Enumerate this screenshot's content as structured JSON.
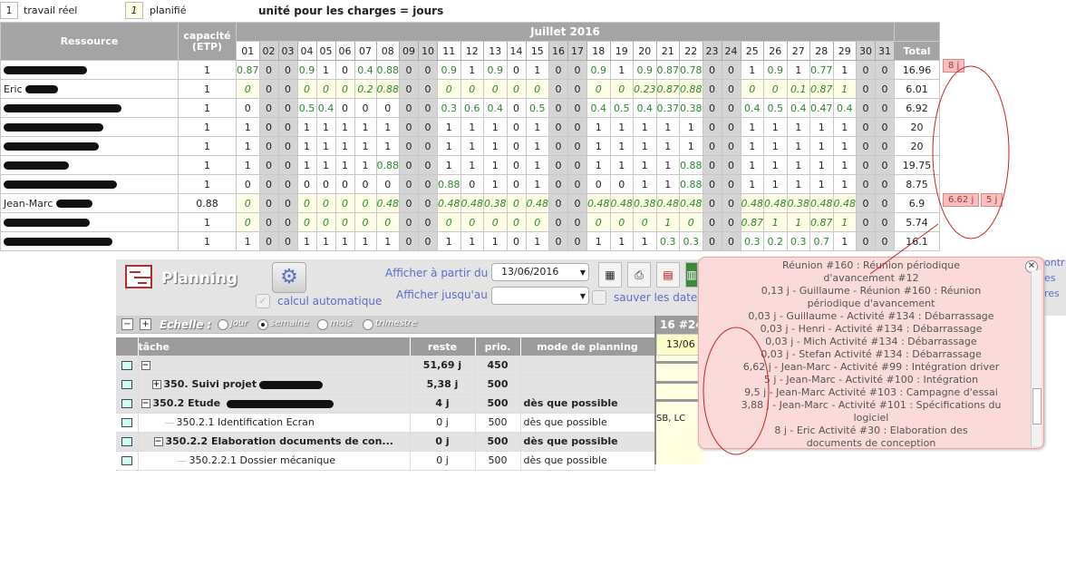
{
  "legend": {
    "real_box": "1",
    "real_label": "travail réel",
    "plan_box": "1",
    "plan_label": "planifié",
    "unit_text": "unité pour les charges = jours"
  },
  "grid": {
    "col_resource": "Ressource",
    "col_capacity": "capacité\n(ETP)",
    "month": "Juillet 2016",
    "col_total": "Total",
    "days": [
      "01",
      "02",
      "03",
      "04",
      "05",
      "06",
      "07",
      "08",
      "09",
      "10",
      "11",
      "12",
      "13",
      "14",
      "15",
      "16",
      "17",
      "18",
      "19",
      "20",
      "21",
      "22",
      "23",
      "24",
      "25",
      "26",
      "27",
      "28",
      "29",
      "30",
      "31"
    ],
    "rows": [
      {
        "name": "",
        "capacity": "1",
        "total": "16.96",
        "values": [
          "0.87",
          "0",
          "0",
          "0.9",
          "1",
          "0",
          "0.4",
          "0.88",
          "0",
          "0",
          "0.9",
          "1",
          "0.9",
          "0",
          "1",
          "0",
          "0",
          "0.9",
          "1",
          "0.9",
          "0.87",
          "0.78",
          "0",
          "0",
          "1",
          "0.9",
          "1",
          "0.77",
          "1",
          "0",
          "0"
        ]
      },
      {
        "name": "Eric ",
        "capacity": "1",
        "total": "6.01",
        "values": [
          "0",
          "0",
          "0",
          "0",
          "0",
          "0",
          "0.2",
          "0.88",
          "0",
          "0",
          "0",
          "0",
          "0",
          "0",
          "0",
          "0",
          "0",
          "0",
          "0",
          "0.23",
          "0.87",
          "0.88",
          "0",
          "0",
          "0",
          "0",
          "0.1",
          "0.87",
          "1",
          "0",
          "0"
        ]
      },
      {
        "name": "",
        "capacity": "1",
        "total": "6.92",
        "values": [
          "0",
          "0",
          "0",
          "0.5",
          "0.4",
          "0",
          "0",
          "0",
          "0",
          "0",
          "0.3",
          "0.6",
          "0.4",
          "0",
          "0.5",
          "0",
          "0",
          "0.4",
          "0.5",
          "0.4",
          "0.37",
          "0.38",
          "0",
          "0",
          "0.4",
          "0.5",
          "0.4",
          "0.47",
          "0.4",
          "0",
          "0"
        ]
      },
      {
        "name": "",
        "capacity": "1",
        "total": "20",
        "values": [
          "1",
          "0",
          "0",
          "1",
          "1",
          "1",
          "1",
          "1",
          "0",
          "0",
          "1",
          "1",
          "1",
          "0",
          "1",
          "0",
          "0",
          "1",
          "1",
          "1",
          "1",
          "1",
          "0",
          "0",
          "1",
          "1",
          "1",
          "1",
          "1",
          "0",
          "0"
        ]
      },
      {
        "name": "",
        "capacity": "1",
        "total": "20",
        "values": [
          "1",
          "0",
          "0",
          "1",
          "1",
          "1",
          "1",
          "1",
          "0",
          "0",
          "1",
          "1",
          "1",
          "0",
          "1",
          "0",
          "0",
          "1",
          "1",
          "1",
          "1",
          "1",
          "0",
          "0",
          "1",
          "1",
          "1",
          "1",
          "1",
          "0",
          "0"
        ]
      },
      {
        "name": "",
        "capacity": "1",
        "total": "19.75",
        "values": [
          "1",
          "0",
          "0",
          "1",
          "1",
          "1",
          "1",
          "0.88",
          "0",
          "0",
          "1",
          "1",
          "1",
          "0",
          "1",
          "0",
          "0",
          "1",
          "1",
          "1",
          "1",
          "0.88",
          "0",
          "0",
          "1",
          "1",
          "1",
          "1",
          "1",
          "0",
          "0"
        ]
      },
      {
        "name": "",
        "capacity": "1",
        "total": "8.75",
        "values": [
          "0",
          "0",
          "0",
          "0",
          "0",
          "0",
          "0",
          "0",
          "0",
          "0",
          "0.88",
          "0",
          "1",
          "0",
          "1",
          "0",
          "0",
          "0",
          "0",
          "1",
          "1",
          "0.88",
          "0",
          "0",
          "1",
          "1",
          "1",
          "1",
          "1",
          "0",
          "0"
        ]
      },
      {
        "name": "Jean-Marc ",
        "capacity": "0.88",
        "total": "6.9",
        "values": [
          "0",
          "0",
          "0",
          "0",
          "0",
          "0",
          "0",
          "0.48",
          "0",
          "0",
          "0.48",
          "0.48",
          "0.38",
          "0",
          "0.48",
          "0",
          "0",
          "0.48",
          "0.48",
          "0.38",
          "0.48",
          "0.48",
          "0",
          "0",
          "0.48",
          "0.48",
          "0.38",
          "0.48",
          "0.48",
          "0",
          "0"
        ]
      },
      {
        "name": "",
        "capacity": "1",
        "total": "5.74",
        "values": [
          "0",
          "0",
          "0",
          "0",
          "0",
          "0",
          "0",
          "0",
          "0",
          "0",
          "0",
          "0",
          "0",
          "0",
          "0",
          "0",
          "0",
          "0",
          "0",
          "0",
          "1",
          "0",
          "0",
          "0",
          "0.87",
          "1",
          "1",
          "0.87",
          "1",
          "0",
          "0"
        ]
      },
      {
        "name": "",
        "capacity": "1",
        "total": "16.1",
        "values": [
          "1",
          "0",
          "0",
          "1",
          "1",
          "1",
          "1",
          "1",
          "0",
          "0",
          "1",
          "1",
          "1",
          "0",
          "1",
          "0",
          "0",
          "1",
          "1",
          "1",
          "0.3",
          "0.3",
          "0",
          "0",
          "0.3",
          "0.2",
          "0.3",
          "0.7",
          "1",
          "0",
          "0"
        ]
      }
    ],
    "badges": {
      "eric": "8 j",
      "jm1": "6.62 j",
      "jm2": "5 j"
    }
  },
  "planning": {
    "title": "Planning",
    "calc_label": "calcul automatique",
    "from_label": "Afficher à partir du",
    "from_value": "13/06/2016",
    "to_label": "Afficher jusqu'au",
    "to_value": "",
    "save_label": "sauver les dates",
    "scale_label": "Echelle :",
    "scale_options": [
      "jour",
      "semaine",
      "mois",
      "trimestre"
    ],
    "scale_selected": "semaine",
    "columns": {
      "task": "tâche",
      "remaining": "reste",
      "priority": "prio.",
      "mode": "mode de planning"
    },
    "tasks": [
      {
        "name": "",
        "remaining": "51,69 j",
        "priority": "450",
        "mode": ""
      },
      {
        "name": "350.  Suivi projet",
        "remaining": "5,38 j",
        "priority": "500",
        "mode": ""
      },
      {
        "name": "350.2 Etude ",
        "remaining": "4 j",
        "priority": "500",
        "mode": "dès que possible"
      },
      {
        "name": "350.2.1 Identification Ecran",
        "remaining": "0 j",
        "priority": "500",
        "mode": "dès que possible"
      },
      {
        "name": "350.2.2 Elaboration documents de con...",
        "remaining": "0 j",
        "priority": "500",
        "mode": "dès que possible"
      },
      {
        "name": "350.2.2.1 Dossier mécanique",
        "remaining": "0 j",
        "priority": "500",
        "mode": "dès que possible"
      }
    ],
    "gantt_week": "16 #24",
    "gantt_day": "13/06",
    "gantt_text": "SB, LC"
  },
  "tooltip": {
    "lines": [
      "Réunion #160 : Réunion périodique",
      "d'avancement  #12",
      "0,13 j - Guillaume  - Réunion #160 : Réunion",
      "périodique d'avancement ",
      "0,03 j - Guillaume  - Activité #134 : Débarrassage",
      "0,03 j - Henri  - Activité #134 : Débarrassage",
      "0,03 j - Mich  Activité #134 : Débarrassage",
      "0,03 j - Stefan  Activité #134 : Débarrassage",
      "6,62 j - Jean-Marc  - Activité #99 : Intégration driver",
      "5 j - Jean-Marc  - Activité #100 : Intégration",
      "9,5 j - Jean-Marc  Activité #103 : Campagne d'essai",
      "3,88 j - Jean-Marc  - Activité #101 : Spécifications du",
      "logiciel",
      "8 j - Eric  Activité #30 : Elaboration des",
      "documents de conception"
    ]
  },
  "side_clip": [
    "ontr",
    "es",
    "res"
  ]
}
